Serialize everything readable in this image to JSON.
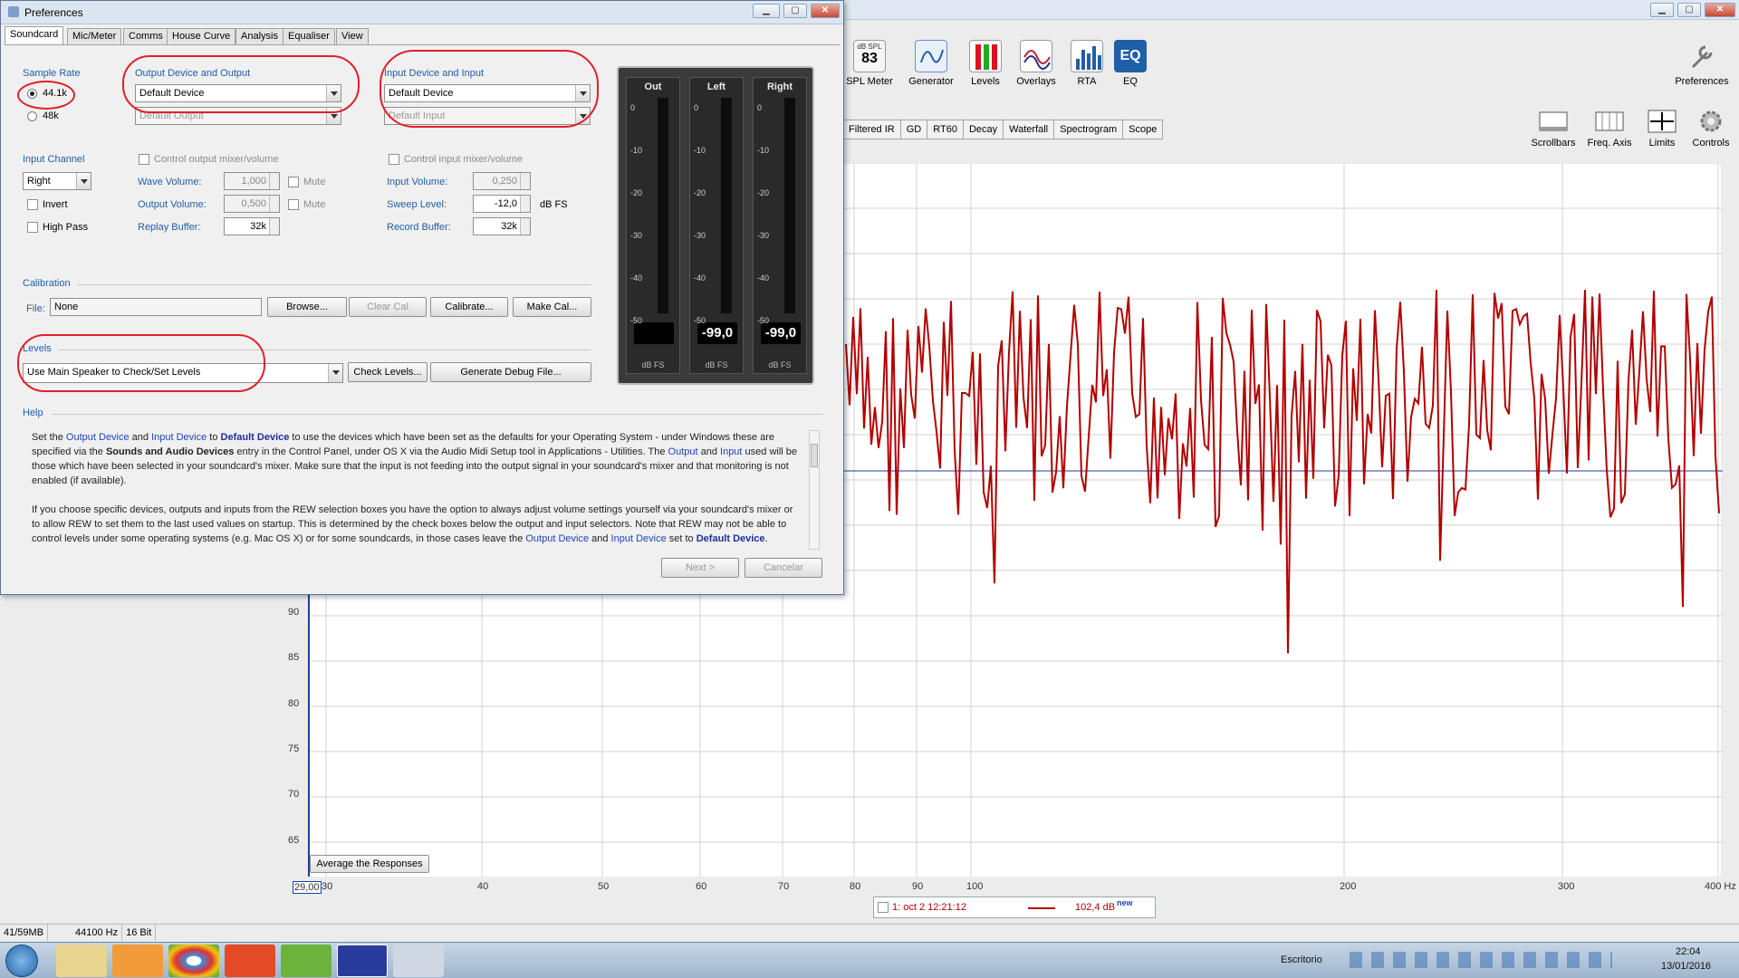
{
  "rew": {
    "toolbar": [
      {
        "label": "SPL Meter",
        "badge_top": "dB SPL",
        "badge_value": "83",
        "icon": "spl-meter-icon"
      },
      {
        "label": "Generator",
        "icon": "generator-icon"
      },
      {
        "label": "Levels",
        "icon": "levels-icon"
      },
      {
        "label": "Overlays",
        "icon": "overlays-icon"
      },
      {
        "label": "RTA",
        "icon": "rta-icon"
      },
      {
        "label": "EQ",
        "icon": "eq-icon"
      }
    ],
    "preferences_label": "Preferences",
    "graph_tabs": [
      "Filtered IR",
      "GD",
      "RT60",
      "Decay",
      "Waterfall",
      "Spectrogram",
      "Scope"
    ],
    "graph_tools": [
      {
        "label": "Scrollbars",
        "icon": "scrollbars-icon"
      },
      {
        "label": "Freq. Axis",
        "icon": "freq-axis-icon"
      },
      {
        "label": "Limits",
        "icon": "limits-icon"
      },
      {
        "label": "Controls",
        "icon": "controls-icon"
      }
    ],
    "y_ticks": [
      "90",
      "85",
      "80",
      "75",
      "70",
      "65"
    ],
    "x_ticks": [
      "29,00",
      "30",
      "40",
      "50",
      "60",
      "70",
      "80",
      "90",
      "100",
      "200",
      "300",
      "400 Hz"
    ],
    "average_button": "Average the Responses",
    "legend": {
      "check": "1: oct 2 12:21:12",
      "value": "102,4 dB",
      "tag": "new"
    },
    "status": [
      "41/59MB",
      "44100 Hz",
      "16 Bit"
    ]
  },
  "prefs": {
    "title": "Preferences",
    "tabs": [
      "Soundcard",
      "Mic/Meter",
      "Comms",
      "House Curve",
      "Analysis",
      "Equaliser",
      "View"
    ],
    "sample_rate": {
      "label": "Sample Rate",
      "opt1": "44.1k",
      "opt2": "48k"
    },
    "output": {
      "label": "Output Device and Output",
      "device": "Default Device",
      "sub": "Default Output",
      "control": "Control output mixer/volume",
      "wave_label": "Wave Volume:",
      "wave": "1,000",
      "out_label": "Output Volume:",
      "out": "0,500",
      "mute": "Mute",
      "replay_label": "Replay Buffer:",
      "replay": "32k"
    },
    "input": {
      "label": "Input Device and Input",
      "device": "Default Device",
      "sub": "Default Input",
      "control": "Control input mixer/volume",
      "vol_label": "Input Volume:",
      "vol": "0,250",
      "sweep_label": "Sweep Level:",
      "sweep": "-12,0",
      "sweep_unit": "dB FS",
      "record_label": "Record Buffer:",
      "record": "32k"
    },
    "input_channel": {
      "label": "Input Channel",
      "value": "Right",
      "invert": "Invert",
      "highpass": "High Pass"
    },
    "calibration": {
      "label": "Calibration",
      "file_label": "File:",
      "file": "None",
      "browse": "Browse...",
      "clear": "Clear Cal",
      "calibrate": "Calibrate...",
      "make": "Make Cal..."
    },
    "levels": {
      "label": "Levels",
      "value": "Use Main Speaker to Check/Set Levels",
      "check": "Check Levels...",
      "debug": "Generate Debug File..."
    },
    "meters": [
      {
        "title": "Out",
        "reading": "",
        "unit": "dB FS"
      },
      {
        "title": "Left",
        "reading": "-99,0",
        "unit": "dB FS"
      },
      {
        "title": "Right",
        "reading": "-99,0",
        "unit": "dB FS"
      }
    ],
    "meter_ticks": [
      "0",
      "-10",
      "-20",
      "-30",
      "-40",
      "-50"
    ],
    "help_label": "Help",
    "next": "Next >",
    "cancel": "Cancelar"
  },
  "taskbar": {
    "lang": "Escritorio",
    "time": "22:04",
    "date": "13/01/2016"
  }
}
